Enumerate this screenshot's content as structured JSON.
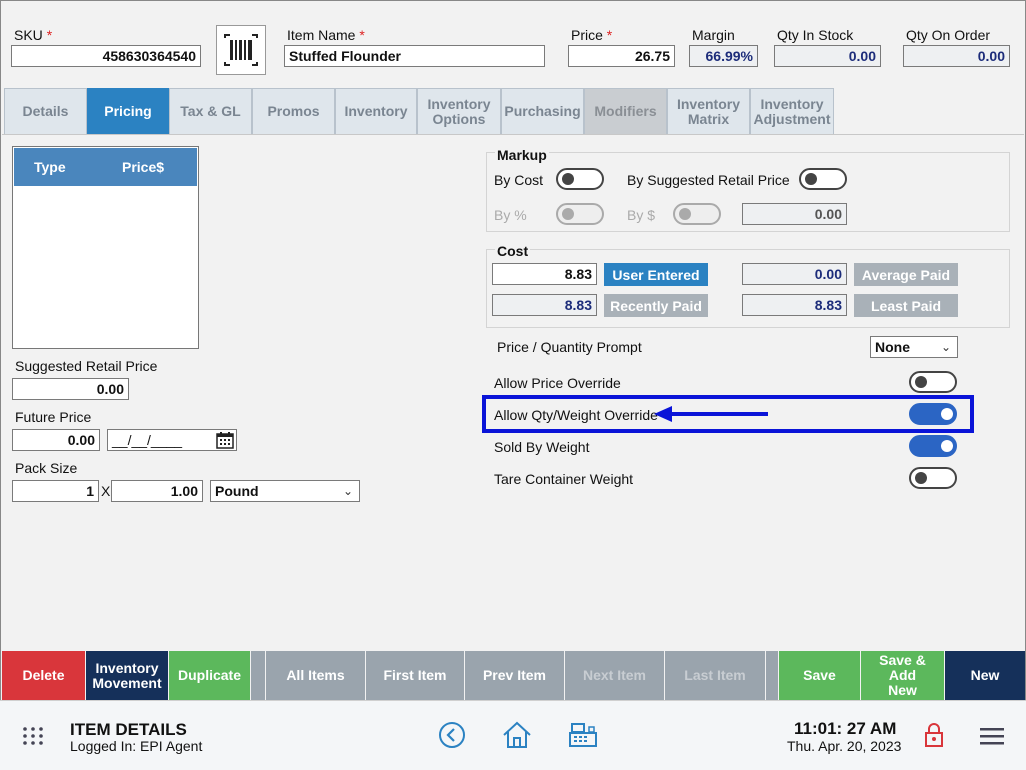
{
  "header": {
    "sku_label": "SKU",
    "sku_value": "458630364540",
    "item_name_label": "Item Name",
    "item_name_value": "Stuffed Flounder",
    "price_label": "Price",
    "price_value": "26.75",
    "margin_label": "Margin",
    "margin_value": "66.99%",
    "qty_in_stock_label": "Qty In Stock",
    "qty_in_stock_value": "0.00",
    "qty_on_order_label": "Qty On Order",
    "qty_on_order_value": "0.00",
    "required_marker": "*",
    "barcode_icon": "barcode-scan-icon"
  },
  "tabs": [
    {
      "label": "Details",
      "state": "normal"
    },
    {
      "label": "Pricing",
      "state": "active"
    },
    {
      "label": "Tax & GL",
      "state": "normal"
    },
    {
      "label": "Promos",
      "state": "normal"
    },
    {
      "label": "Inventory",
      "state": "normal"
    },
    {
      "label": "Inventory Options",
      "state": "normal"
    },
    {
      "label": "Purchasing",
      "state": "normal"
    },
    {
      "label": "Modifiers",
      "state": "disabled"
    },
    {
      "label": "Inventory Matrix",
      "state": "normal"
    },
    {
      "label": "Inventory Adjustment",
      "state": "normal"
    }
  ],
  "price_table": {
    "col_type": "Type",
    "col_price": "Price$"
  },
  "left": {
    "suggested_retail_label": "Suggested Retail Price",
    "suggested_retail_value": "0.00",
    "future_price_label": "Future Price",
    "future_price_value": "0.00",
    "future_date_value": "__/__/____",
    "calendar_icon": "calendar-icon",
    "pack_size_label": "Pack Size",
    "pack_size_qty": "1",
    "pack_size_x": "X",
    "pack_size_amount": "1.00",
    "pack_size_unit": "Pound"
  },
  "markup": {
    "title": "Markup",
    "by_cost_label": "By Cost",
    "by_suggested_label": "By Suggested Retail Price",
    "by_percent_label": "By %",
    "by_dollar_label": "By $",
    "value": "0.00"
  },
  "cost": {
    "title": "Cost",
    "user_entered_value": "8.83",
    "user_entered_button": "User Entered",
    "average_paid_value": "0.00",
    "average_paid_button": "Average Paid",
    "recently_paid_value": "8.83",
    "recently_paid_button": "Recently Paid",
    "least_paid_value": "8.83",
    "least_paid_button": "Least Paid"
  },
  "options": {
    "price_qty_prompt_label": "Price / Quantity Prompt",
    "price_qty_prompt_value": "None",
    "allow_price_override_label": "Allow Price Override",
    "allow_price_override": false,
    "allow_qty_weight_override_label": "Allow Qty/Weight Override",
    "allow_qty_weight_override": true,
    "sold_by_weight_label": "Sold By Weight",
    "sold_by_weight": true,
    "tare_container_label": "Tare Container Weight",
    "tare_container": false
  },
  "bottom_bar": [
    {
      "label": "Delete",
      "color": "#d9363b"
    },
    {
      "label": "Inventory Movement",
      "color": "#15305a"
    },
    {
      "label": "Duplicate",
      "color": "#5cb85c"
    },
    {
      "label": "All Items",
      "color": "#9aa4ad"
    },
    {
      "label": "First Item",
      "color": "#9aa4ad"
    },
    {
      "label": "Prev Item",
      "color": "#9aa4ad"
    },
    {
      "label": "Next Item",
      "color": "#9aa4ad"
    },
    {
      "label": "Last Item",
      "color": "#9aa4ad"
    },
    {
      "label": "Save",
      "color": "#5cb85c"
    },
    {
      "label": "Save & Add New",
      "color": "#5cb85c"
    },
    {
      "label": "New",
      "color": "#15305a"
    }
  ],
  "footer": {
    "title": "ITEM DETAILS",
    "logged_in": "Logged In:  EPI Agent",
    "time": "11:01: 27 AM",
    "date": "Thu. Apr. 20, 2023"
  },
  "colors": {
    "accent": "#2b82c2",
    "highlight_box": "#0a14d8",
    "toggle_on": "#2b65c4"
  }
}
